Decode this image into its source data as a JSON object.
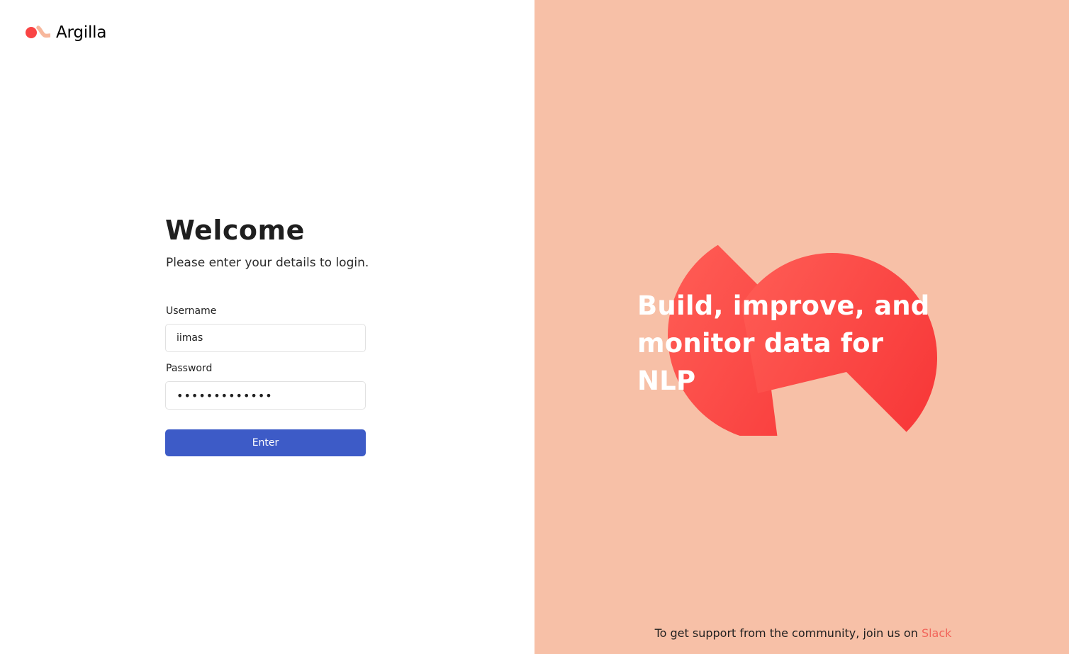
{
  "brand": {
    "name": "Argilla",
    "logo_icon": "argilla-logo-icon"
  },
  "login": {
    "title": "Welcome",
    "subtitle": "Please enter your details to login.",
    "username_label": "Username",
    "username_value": "iimas",
    "password_label": "Password",
    "password_value": "iimasiimasiim",
    "submit_label": "Enter"
  },
  "hero": {
    "tagline": "Build, improve, and monitor data for NLP",
    "support_text": "To get support from the community, join us on",
    "support_link": "Slack"
  },
  "colors": {
    "panel_background": "#f7c0a7",
    "accent_red": "#f94444",
    "button_blue": "#3d5bc7",
    "link": "#f2645a"
  }
}
